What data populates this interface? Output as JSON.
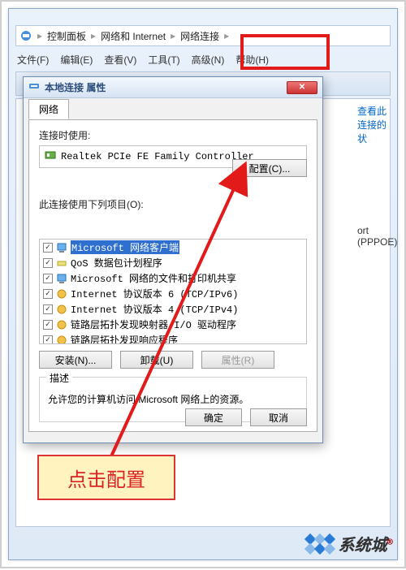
{
  "breadcrumbs": {
    "icon": "network-center-icon",
    "seg1": "控制面板",
    "seg2": "网络和 Internet",
    "seg3": "网络连接"
  },
  "menus": {
    "file": "文件(F)",
    "edit": "编辑(E)",
    "view": "查看(V)",
    "tools": "工具(T)",
    "advanced": "高级(N)",
    "help": "帮助(H)"
  },
  "right_link": "查看此连接的状",
  "pppoe_text": "ort (PPPOE)",
  "dialog": {
    "title": "本地连接 属性",
    "tab_network": "网络",
    "connect_using_label": "连接时使用:",
    "adapter_name": "Realtek PCIe FE Family Controller",
    "configure_btn": "配置(C)...",
    "items_label": "此连接使用下列项目(O):",
    "items": [
      {
        "checked": true,
        "icon": "client-icon",
        "text": "Microsoft 网络客户端",
        "selected": true
      },
      {
        "checked": true,
        "icon": "qos-icon",
        "text": "QoS 数据包计划程序"
      },
      {
        "checked": true,
        "icon": "client-icon",
        "text": "Microsoft 网络的文件和打印机共享"
      },
      {
        "checked": true,
        "icon": "protocol-icon",
        "text": "Internet 协议版本 6 (TCP/IPv6)"
      },
      {
        "checked": true,
        "icon": "protocol-icon",
        "text": "Internet 协议版本 4 (TCP/IPv4)"
      },
      {
        "checked": true,
        "icon": "protocol-icon",
        "text": "链路层拓扑发现映射器 I/O 驱动程序"
      },
      {
        "checked": true,
        "icon": "protocol-icon",
        "text": "链路层拓扑发现响应程序"
      }
    ],
    "install_btn": "安装(N)...",
    "uninstall_btn": "卸载(U)",
    "properties_btn": "属性(R)",
    "desc_legend": "描述",
    "desc_text": "允许您的计算机访问 Microsoft 网络上的资源。",
    "ok_btn": "确定",
    "cancel_btn": "取消"
  },
  "callout_text": "点击配置",
  "watermark": "系统城"
}
